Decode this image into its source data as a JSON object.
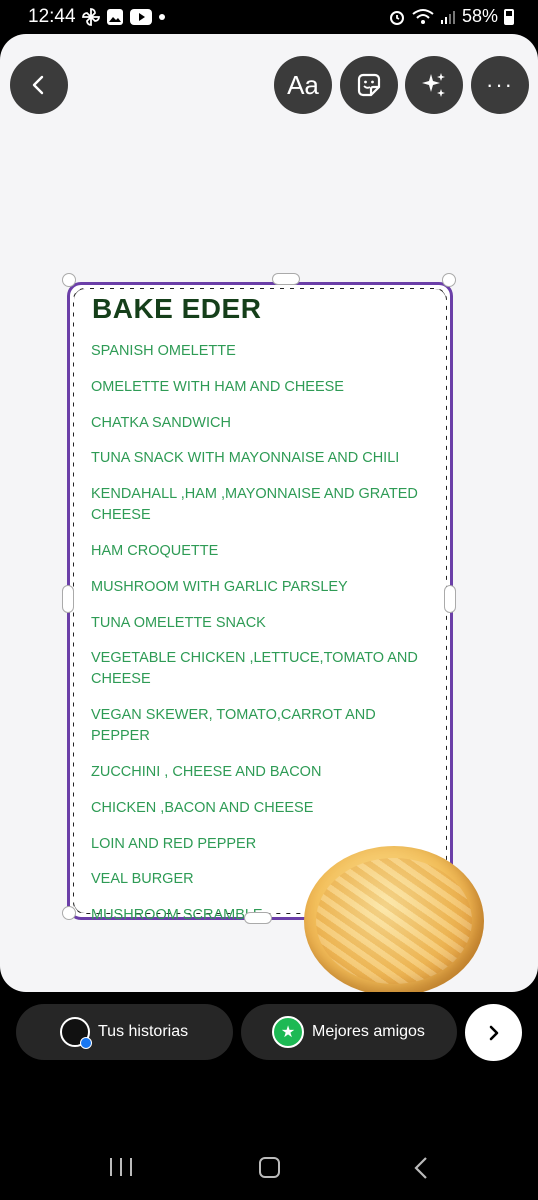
{
  "status_bar": {
    "time": "12:44",
    "battery": "58%",
    "left_icons": [
      "pinwheel-icon",
      "gallery-icon",
      "youtube-icon",
      "dot-icon"
    ],
    "right_icons": [
      "alarm-icon",
      "wifi-icon",
      "signal-icon",
      "battery-icon"
    ]
  },
  "editor_toolbar": {
    "text_label": "Aa",
    "more_label": "···",
    "icons": [
      "back-chevron-icon",
      "text-icon",
      "sticker-icon",
      "sparkles-icon",
      "more-icon"
    ]
  },
  "menu": {
    "title": "BAKE EDER",
    "items": [
      "SPANISH OMELETTE",
      "OMELETTE WITH HAM AND CHEESE",
      "CHATKA SANDWICH",
      "TUNA SNACK WITH MAYONNAISE AND CHILI",
      "KENDAHALL ,HAM ,MAYONNAISE AND GRATED CHEESE",
      "HAM CROQUETTE",
      "MUSHROOM WITH GARLIC PARSLEY",
      "TUNA OMELETTE SNACK",
      "VEGETABLE CHICKEN ,LETTUCE,TOMATO AND CHEESE",
      "VEGAN SKEWER, TOMATO,CARROT AND PEPPER",
      "ZUCCHINI , CHEESE AND BACON",
      "CHICKEN ,BACON AND CHEESE",
      "LOIN AND RED PEPPER",
      "VEAL BURGER",
      "MUSHROOM SCRAMBLE"
    ],
    "colors": {
      "title": "#153f1a",
      "items": "#2e9b55",
      "frame": "#6b3fa8"
    }
  },
  "share_bar": {
    "stories_label": "Tus historias",
    "close_friends_label": "Mejores amigos",
    "close_friends_color": "#1db954",
    "next_icon": "chevron-right-icon"
  },
  "nav_bar": {
    "icons": [
      "recent-apps-icon",
      "home-icon",
      "back-icon"
    ]
  }
}
